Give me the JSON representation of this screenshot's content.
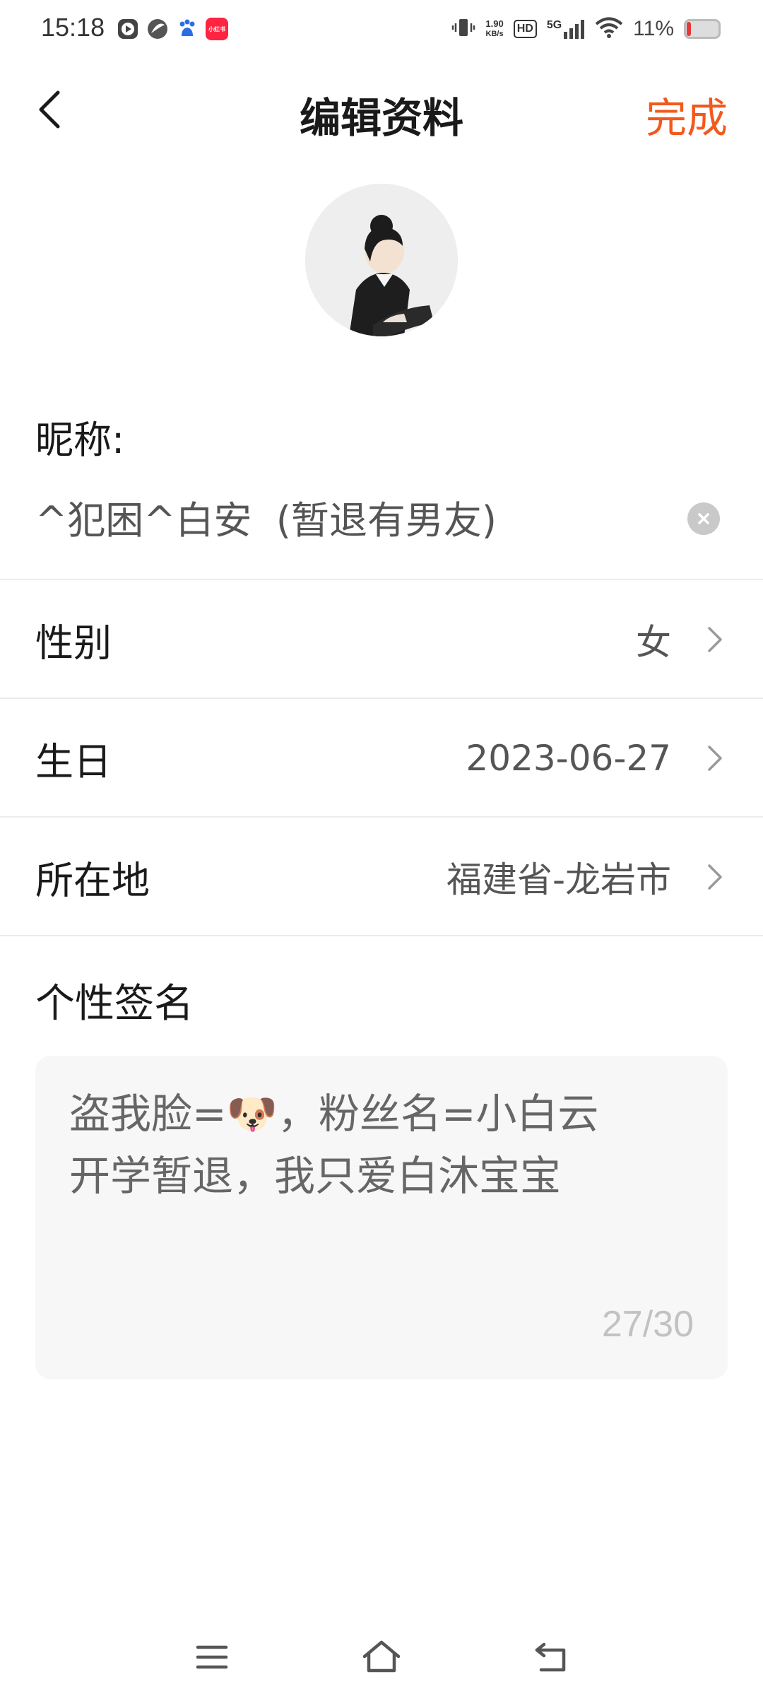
{
  "status_bar": {
    "time": "15:18",
    "net_speed_value": "1.90",
    "net_speed_unit": "KB/s",
    "hd": "HD",
    "network": "5G",
    "battery_percent": "11%",
    "battery_level": 0.11,
    "app_icons": [
      "play-icon",
      "leaf-icon",
      "baidu-icon",
      "xiaohongshu-icon"
    ],
    "xiaohongshu_label": "小红书"
  },
  "header": {
    "title": "编辑资料",
    "done_label": "完成",
    "accent_color": "#f2591d"
  },
  "nickname": {
    "label": "昵称:",
    "value": "^犯困^白安  (暂退有男友)"
  },
  "rows": {
    "gender": {
      "label": "性别",
      "value": "女"
    },
    "birthday": {
      "label": "生日",
      "value": "2023-06-27"
    },
    "location": {
      "label": "所在地",
      "value": "福建省-龙岩市"
    }
  },
  "signature": {
    "label": "个性签名",
    "text": "盗我脸=🐶，粉丝名=小白云\n开学暂退，我只爱白沐宝宝",
    "count": "27/30"
  },
  "nav": {
    "icons": [
      "menu-icon",
      "home-icon",
      "back-icon"
    ]
  }
}
